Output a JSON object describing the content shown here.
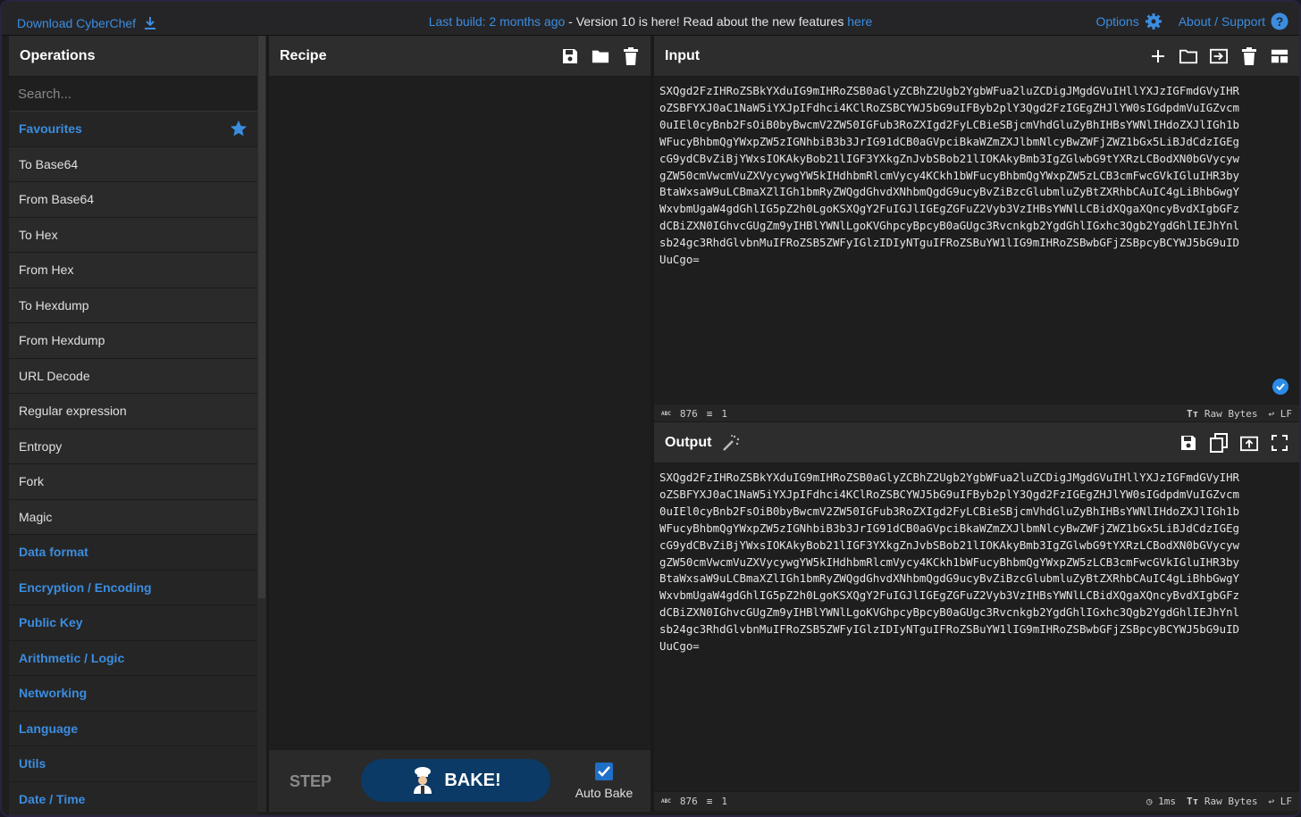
{
  "banner": {
    "download_label": "Download CyberChef",
    "notice_prefix": "Last build: 2 months ago",
    "notice_middle": " - Version 10 is here! Read about the new features ",
    "notice_link": "here",
    "options_label": "Options",
    "about_label": "About / Support"
  },
  "operations": {
    "title": "Operations",
    "search_placeholder": "Search...",
    "items": [
      {
        "label": "Favourites",
        "type": "category"
      },
      {
        "label": "To Base64",
        "type": "op"
      },
      {
        "label": "From Base64",
        "type": "op"
      },
      {
        "label": "To Hex",
        "type": "op"
      },
      {
        "label": "From Hex",
        "type": "op"
      },
      {
        "label": "To Hexdump",
        "type": "op"
      },
      {
        "label": "From Hexdump",
        "type": "op"
      },
      {
        "label": "URL Decode",
        "type": "op"
      },
      {
        "label": "Regular expression",
        "type": "op"
      },
      {
        "label": "Entropy",
        "type": "op"
      },
      {
        "label": "Fork",
        "type": "op"
      },
      {
        "label": "Magic",
        "type": "op"
      },
      {
        "label": "Data format",
        "type": "category"
      },
      {
        "label": "Encryption / Encoding",
        "type": "category"
      },
      {
        "label": "Public Key",
        "type": "category"
      },
      {
        "label": "Arithmetic / Logic",
        "type": "category"
      },
      {
        "label": "Networking",
        "type": "category"
      },
      {
        "label": "Language",
        "type": "category"
      },
      {
        "label": "Utils",
        "type": "category"
      },
      {
        "label": "Date / Time",
        "type": "category"
      }
    ]
  },
  "recipe": {
    "title": "Recipe",
    "step_label": "STEP",
    "bake_label": "BAKE!",
    "autobake_label": "Auto Bake"
  },
  "input": {
    "title": "Input",
    "lines": [
      "SXQgd2FzIHRoZSBkYXduIG9mIHRoZSB0aGlyZCBhZ2Ugb2YgbWFua2luZCDigJMgdGVuIHllYXJzIGFmdGVyIHR",
      "oZSBFYXJ0aC1NaW5iYXJpIFdhci4KClRoZSBCYWJ5bG9uIFByb2plY3Qgd2FzIGEgZHJlYW0sIGdpdmVuIGZvcm",
      "0uIEl0cyBnb2FsOiB0byBwcmV2ZW50IGFub3RoZXIgd2FyLCBieSBjcmVhdGluZyBhIHBsYWNlIHdoZXJlIGh1b",
      "WFucyBhbmQgYWxpZW5zIGNhbiB3b3JrIG91dCB0aGVpciBkaWZmZXJlbmNlcyBwZWFjZWZ1bGx5LiBJdCdzIGEg",
      "cG9ydCBvZiBjYWxsIOKAkyBob21lIGF3YXkgZnJvbSBob21lIOKAkyBmb3IgZGlwbG9tYXRzLCBodXN0bGVycyw",
      "gZW50cmVwcmVuZXVycywgYW5kIHdhbmRlcmVycy4KCkh1bWFucyBhbmQgYWxpZW5zLCB3cmFwcGVkIGluIHR3by",
      "BtaWxsaW9uLCBmaXZlIGh1bmRyZWQgdGhvdXNhbmQgdG9ucyBvZiBzcGlubmluZyBtZXRhbCAuIC4gLiBhbGwgY",
      "WxvbmUgaW4gdGhlIG5pZ2h0LgoKSXQgY2FuIGJlIGEgZGFuZ2Vyb3VzIHBsYWNlLCBidXQgaXQncyBvdXIgbGFz",
      "dCBiZXN0IGhvcGUgZm9yIHBlYWNlLgoKVGhpcyBpcyB0aGUgc3Rvcnkgb2YgdGhlIGxhc3Qgb2YgdGhlIEJhYnl",
      "sb24gc3RhdGlvbnMuIFRoZSB5ZWFyIGlzIDIyNTguIFRoZSBuYW1lIG9mIHRoZSBwbGFjZSBpcyBCYWJ5bG9uID",
      "UuCgo="
    ],
    "length": "876",
    "lines_count": "1",
    "encoding": "Raw Bytes",
    "eol": "LF"
  },
  "output": {
    "title": "Output",
    "lines": [
      "SXQgd2FzIHRoZSBkYXduIG9mIHRoZSB0aGlyZCBhZ2Ugb2YgbWFua2luZCDigJMgdGVuIHllYXJzIGFmdGVyIHR",
      "oZSBFYXJ0aC1NaW5iYXJpIFdhci4KClRoZSBCYWJ5bG9uIFByb2plY3Qgd2FzIGEgZHJlYW0sIGdpdmVuIGZvcm",
      "0uIEl0cyBnb2FsOiB0byBwcmV2ZW50IGFub3RoZXIgd2FyLCBieSBjcmVhdGluZyBhIHBsYWNlIHdoZXJlIGh1b",
      "WFucyBhbmQgYWxpZW5zIGNhbiB3b3JrIG91dCB0aGVpciBkaWZmZXJlbmNlcyBwZWFjZWZ1bGx5LiBJdCdzIGEg",
      "cG9ydCBvZiBjYWxsIOKAkyBob21lIGF3YXkgZnJvbSBob21lIOKAkyBmb3IgZGlwbG9tYXRzLCBodXN0bGVycyw",
      "gZW50cmVwcmVuZXVycywgYW5kIHdhbmRlcmVycy4KCkh1bWFucyBhbmQgYWxpZW5zLCB3cmFwcGVkIGluIHR3by",
      "BtaWxsaW9uLCBmaXZlIGh1bmRyZWQgdGhvdXNhbmQgdG9ucyBvZiBzcGlubmluZyBtZXRhbCAuIC4gLiBhbGwgY",
      "WxvbmUgaW4gdGhlIG5pZ2h0LgoKSXQgY2FuIGJlIGEgZGFuZ2Vyb3VzIHBsYWNlLCBidXQgaXQncyBvdXIgbGFz",
      "dCBiZXN0IGhvcGUgZm9yIHBlYWNlLgoKVGhpcyBpcyB0aGUgc3Rvcnkgb2YgdGhlIGxhc3Qgb2YgdGhlIEJhYnl",
      "sb24gc3RhdGlvbnMuIFRoZSB5ZWFyIGlzIDIyNTguIFRoZSBuYW1lIG9mIHRoZSBwbGFjZSBpcyBCYWJ5bG9uID",
      "UuCgo="
    ],
    "length": "876",
    "lines_count": "1",
    "time": "1ms",
    "encoding": "Raw Bytes",
    "eol": "LF"
  },
  "colors": {
    "accent": "#3b8de0",
    "bake_button": "#0b3a66"
  }
}
